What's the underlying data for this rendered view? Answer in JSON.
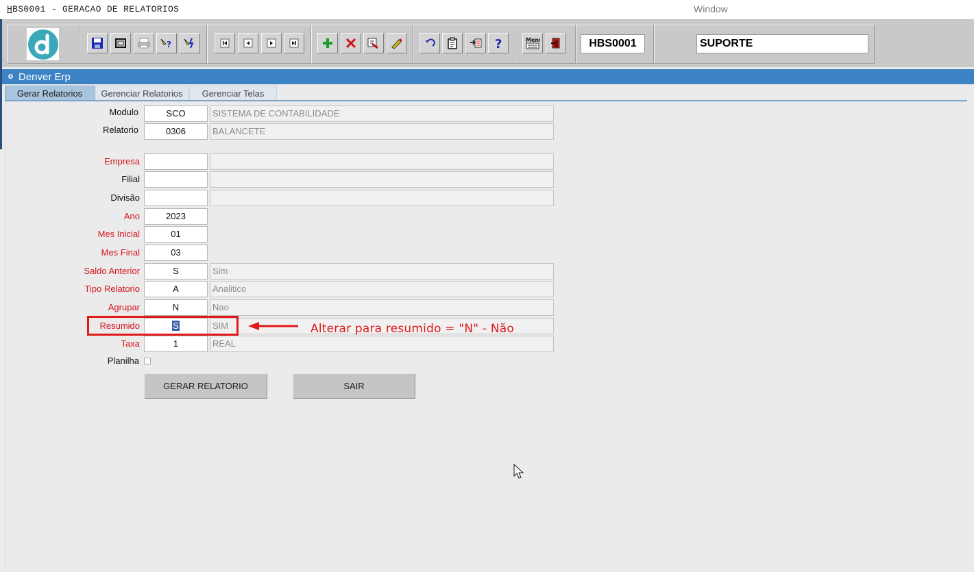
{
  "window": {
    "title": "HBS0001 - GERACAO DE RELATORIOS",
    "menu": "Window"
  },
  "toolbar": {
    "icons": [
      "app-logo-icon",
      "save-icon",
      "window-icon",
      "print-icon",
      "query-icon",
      "execute-query-icon",
      "first-record-icon",
      "previous-record-icon",
      "next-record-icon",
      "last-record-icon",
      "insert-record-icon",
      "delete-record-icon",
      "edit-record-icon",
      "clear-icon",
      "undo-icon",
      "clipboard-icon",
      "lov-icon",
      "help-icon",
      "menu-icon",
      "exit-icon"
    ],
    "form_code": "HBS0001",
    "user": "SUPORTE",
    "menu_icon_text": "Menu"
  },
  "frame": {
    "title": "Denver Erp"
  },
  "tabs": [
    {
      "label": "Gerar Relatorios",
      "active": true
    },
    {
      "label": "Gerenciar Relatorios",
      "active": false
    },
    {
      "label": "Gerenciar Telas",
      "active": false
    }
  ],
  "form": {
    "modulo": {
      "label": "Modulo",
      "code": "SCO",
      "desc": "SISTEMA DE CONTABILIDADE"
    },
    "relatorio": {
      "label": "Relatorio",
      "code": "0306",
      "desc": "BALANCETE"
    },
    "empresa": {
      "label": "Empresa",
      "code": "",
      "desc": ""
    },
    "filial": {
      "label": "Filial",
      "code": "",
      "desc": ""
    },
    "divisao": {
      "label": "Divisão",
      "code": "",
      "desc": ""
    },
    "ano": {
      "label": "Ano",
      "code": "2023"
    },
    "mes_inicial": {
      "label": "Mes Inicial",
      "code": "01"
    },
    "mes_final": {
      "label": "Mes Final",
      "code": "03"
    },
    "saldo_anterior": {
      "label": "Saldo Anterior",
      "code": "S",
      "desc": "Sim"
    },
    "tipo_relatorio": {
      "label": "Tipo Relatorio",
      "code": "A",
      "desc": "Analitico"
    },
    "agrupar": {
      "label": "Agrupar",
      "code": "N",
      "desc": "Nao"
    },
    "resumido": {
      "label": "Resumido",
      "code": "S",
      "desc": "SIM"
    },
    "taxa": {
      "label": "Taxa",
      "code": "1",
      "desc": "REAL"
    },
    "planilha": {
      "label": "Planilha",
      "checked": false
    }
  },
  "buttons": {
    "gerar": "GERAR RELATORIO",
    "sair": "SAIR"
  },
  "annotation": {
    "text": "Alterar para resumido = \"N\" - Não",
    "color": "#e01818"
  },
  "colors": {
    "required_label": "#d4161c",
    "frame_header": "#3b83c4",
    "selection": "#3b63a8"
  }
}
